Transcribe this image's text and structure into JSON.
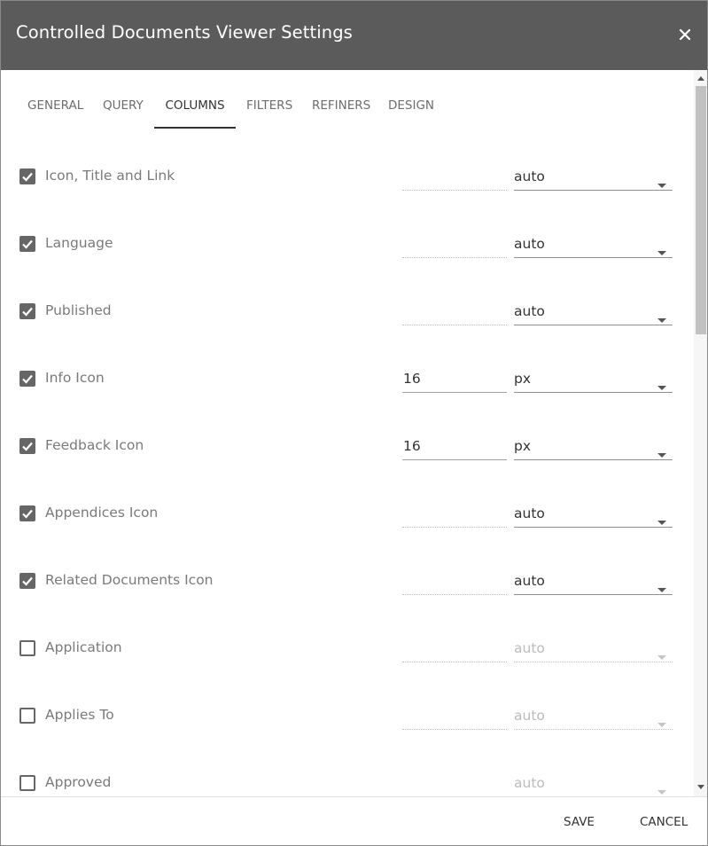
{
  "dialog": {
    "title": "Controlled Documents Viewer Settings"
  },
  "tabs": [
    {
      "label": "GENERAL"
    },
    {
      "label": "QUERY"
    },
    {
      "label": "COLUMNS"
    },
    {
      "label": "FILTERS"
    },
    {
      "label": "REFINERS"
    },
    {
      "label": "DESIGN"
    }
  ],
  "active_tab": "COLUMNS",
  "columns": [
    {
      "label": "Icon, Title and Link",
      "checked": true,
      "width": "",
      "unit": "auto"
    },
    {
      "label": "Language",
      "checked": true,
      "width": "",
      "unit": "auto"
    },
    {
      "label": "Published",
      "checked": true,
      "width": "",
      "unit": "auto"
    },
    {
      "label": "Info Icon",
      "checked": true,
      "width": "16",
      "unit": "px"
    },
    {
      "label": "Feedback Icon",
      "checked": true,
      "width": "16",
      "unit": "px"
    },
    {
      "label": "Appendices Icon",
      "checked": true,
      "width": "",
      "unit": "auto"
    },
    {
      "label": "Related Documents Icon",
      "checked": true,
      "width": "",
      "unit": "auto"
    },
    {
      "label": "Application",
      "checked": false,
      "width": "",
      "unit": "auto"
    },
    {
      "label": "Applies To",
      "checked": false,
      "width": "",
      "unit": "auto"
    },
    {
      "label": "Approved",
      "checked": false,
      "width": "",
      "unit": "auto"
    }
  ],
  "footer": {
    "save_label": "SAVE",
    "cancel_label": "CANCEL"
  }
}
